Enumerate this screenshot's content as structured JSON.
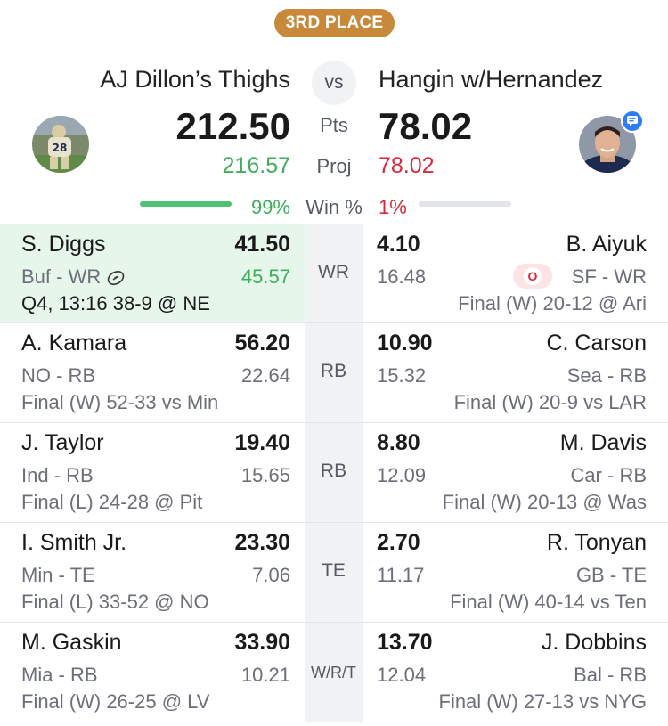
{
  "badge": "3RD PLACE",
  "matchup": {
    "vs": "vs",
    "pts_label": "Pts",
    "proj_label": "Proj",
    "win_label": "Win %",
    "left": {
      "name": "AJ Dillon’s Thighs",
      "score": "212.50",
      "proj": "216.57",
      "win_pct": "99%",
      "win_fraction": 0.99
    },
    "right": {
      "name": "Hangin w/Hernandez",
      "score": "78.02",
      "proj": "78.02",
      "win_pct": "1%",
      "win_fraction": 0.01
    }
  },
  "colors": {
    "badge": "#c8893b",
    "positive": "#3eae5d",
    "negative": "#d8283c",
    "winning_bg": "#e7f6ea",
    "mid_bg": "#f1f2f4"
  },
  "rows": [
    {
      "slot": "WR",
      "left": {
        "name": "S. Diggs",
        "pts": "41.50",
        "info": "Buf - WR",
        "proj": "45.57",
        "game": "Q4, 13:16 38-9 @ NE",
        "live": true,
        "icon": "football-icon"
      },
      "right": {
        "name": "B. Aiyuk",
        "pts": "4.10",
        "info": "SF - WR",
        "proj": "16.48",
        "game": "Final (W) 20-12 @ Ari",
        "status": "O"
      }
    },
    {
      "slot": "RB",
      "left": {
        "name": "A. Kamara",
        "pts": "56.20",
        "info": "NO - RB",
        "proj": "22.64",
        "game": "Final (W) 52-33 vs Min"
      },
      "right": {
        "name": "C. Carson",
        "pts": "10.90",
        "info": "Sea - RB",
        "proj": "15.32",
        "game": "Final (W) 20-9 vs LAR"
      }
    },
    {
      "slot": "RB",
      "left": {
        "name": "J. Taylor",
        "pts": "19.40",
        "info": "Ind - RB",
        "proj": "15.65",
        "game": "Final (L) 24-28 @ Pit"
      },
      "right": {
        "name": "M. Davis",
        "pts": "8.80",
        "info": "Car - RB",
        "proj": "12.09",
        "game": "Final (W) 20-13 @ Was"
      }
    },
    {
      "slot": "TE",
      "left": {
        "name": "I. Smith Jr.",
        "pts": "23.30",
        "info": "Min - TE",
        "proj": "7.06",
        "game": "Final (L) 33-52 @ NO"
      },
      "right": {
        "name": "R. Tonyan",
        "pts": "2.70",
        "info": "GB - TE",
        "proj": "11.17",
        "game": "Final (W) 40-14 vs Ten"
      }
    },
    {
      "slot": "W/R/T",
      "left": {
        "name": "M. Gaskin",
        "pts": "33.90",
        "info": "Mia - RB",
        "proj": "10.21",
        "game": "Final (W) 26-25 @ LV"
      },
      "right": {
        "name": "J. Dobbins",
        "pts": "13.70",
        "info": "Bal - RB",
        "proj": "12.04",
        "game": "Final (W) 27-13 vs NYG"
      }
    }
  ]
}
